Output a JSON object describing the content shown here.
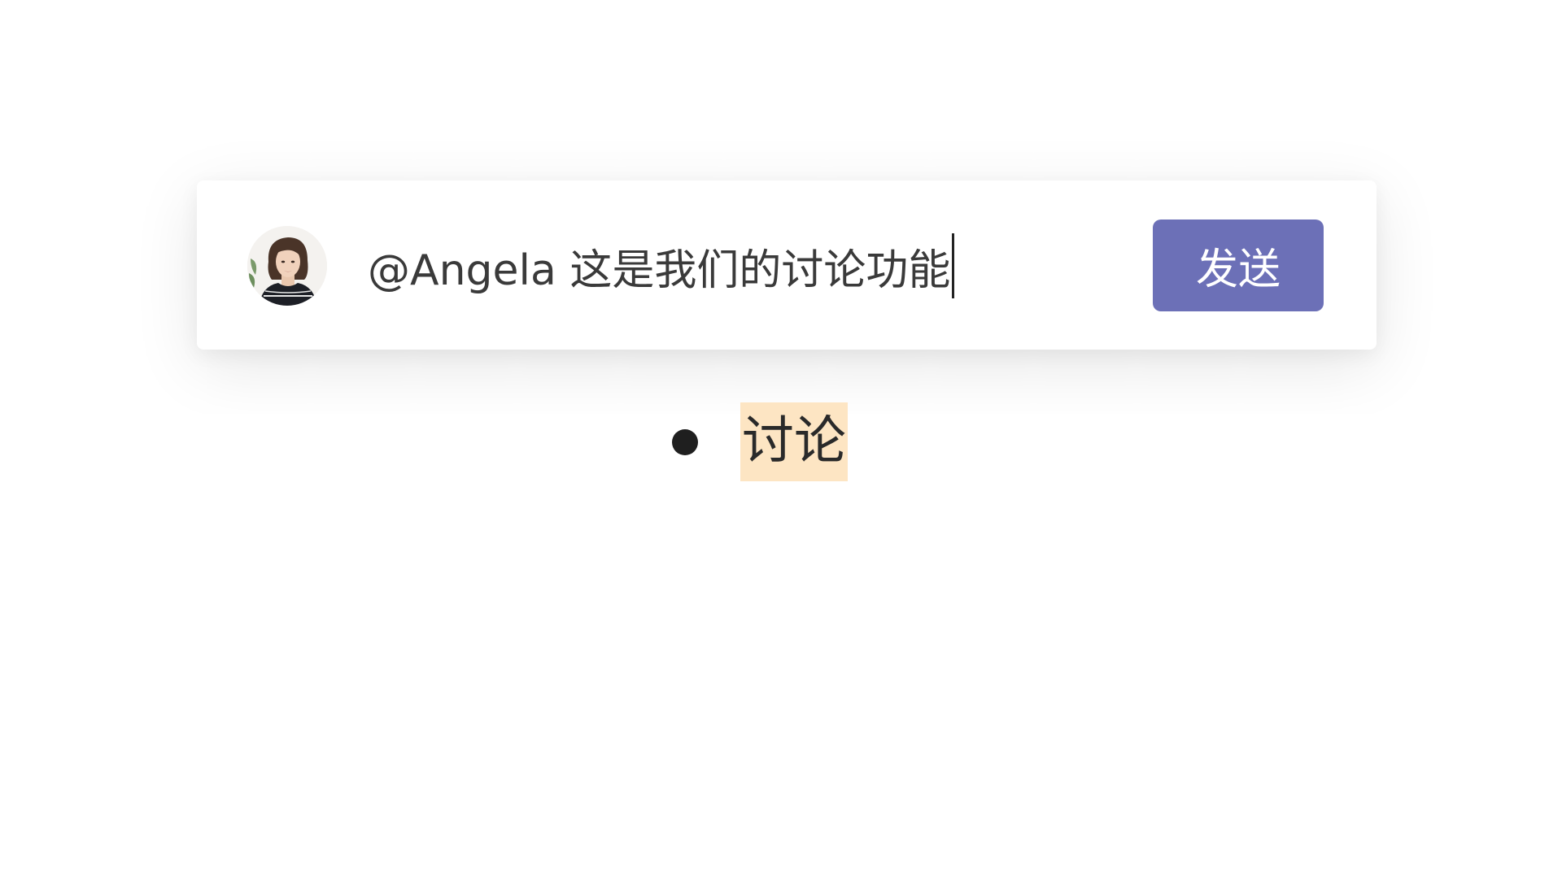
{
  "composer": {
    "input_value": "@Angela 这是我们的讨论功能",
    "send_label": "发送",
    "accent_color": "#6c70b7"
  },
  "avatar": {
    "icon": "user-avatar-photo"
  },
  "mention_suggestions": [
    {
      "label": "讨论",
      "highlight_color": "#fde5c3"
    }
  ]
}
